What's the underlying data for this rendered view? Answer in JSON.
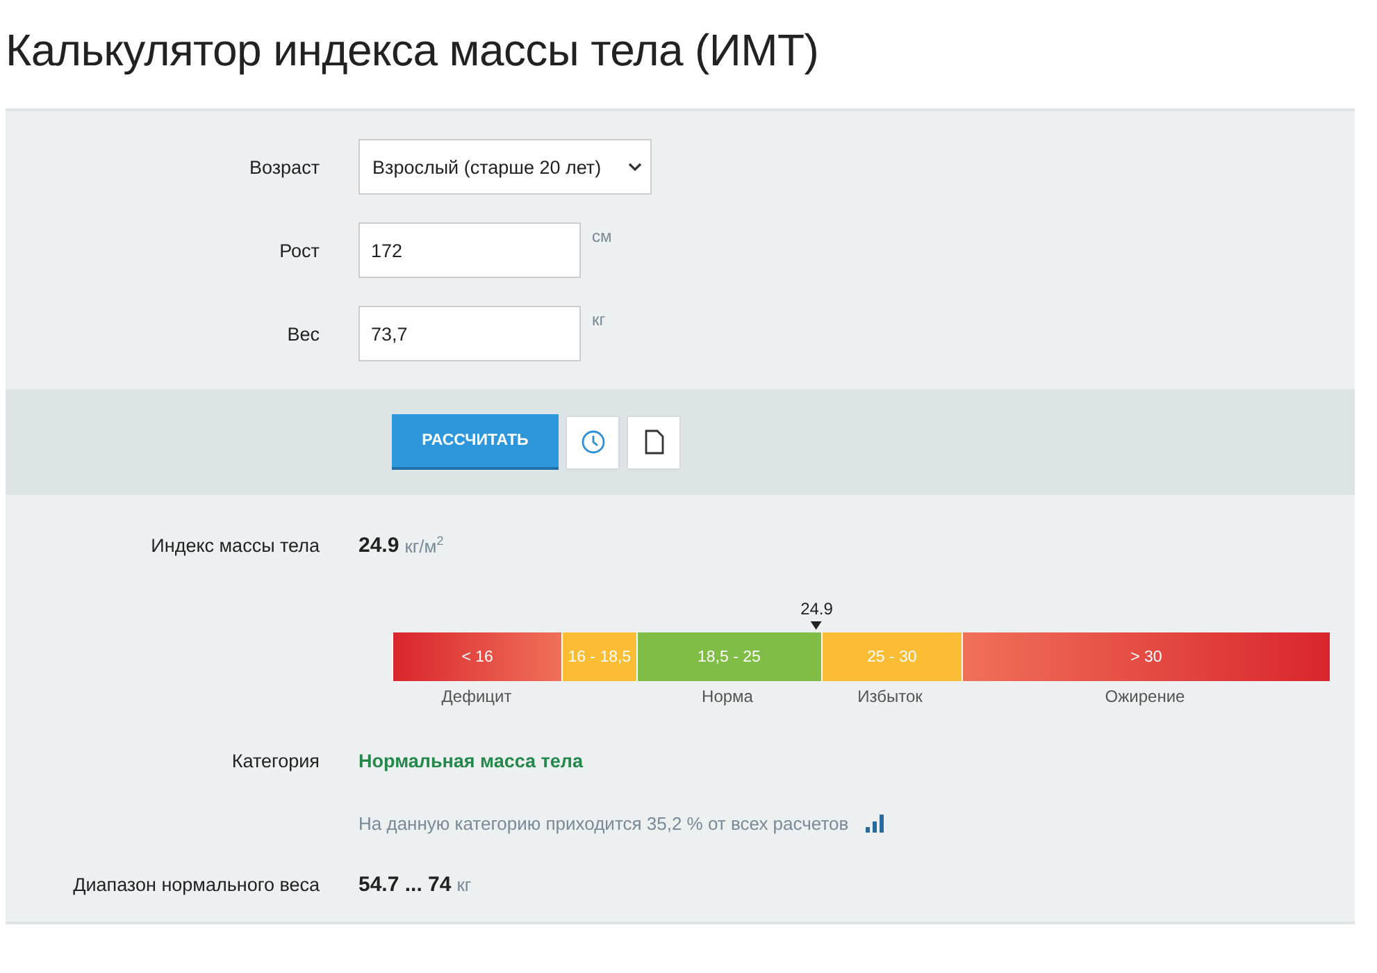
{
  "title": "Калькулятор индекса массы тела (ИМТ)",
  "form": {
    "age": {
      "label": "Возраст",
      "value": "Взрослый (старше 20 лет)"
    },
    "height": {
      "label": "Рост",
      "value": "172",
      "unit": "см"
    },
    "weight": {
      "label": "Вес",
      "value": "73,7",
      "unit": "кг"
    }
  },
  "actions": {
    "calculate": "РАССЧИТАТЬ"
  },
  "result": {
    "label": "Индекс массы тела",
    "value": "24.9",
    "unit": "кг/м",
    "unit_sup": "2",
    "scale": {
      "marker": {
        "label": "24.9",
        "level": 0.453
      },
      "segments": [
        {
          "label": "< 16",
          "caption": "Дефицит",
          "kind": "gradient-red-left"
        },
        {
          "label": "16 - 18,5",
          "kind": "yellow"
        },
        {
          "label": "18,5 - 25",
          "caption": "Норма",
          "kind": "green"
        },
        {
          "label": "25 - 30",
          "caption": "Избыток",
          "kind": "yellow"
        },
        {
          "label": "> 30",
          "caption": "Ожирение",
          "kind": "gradient-red-right"
        }
      ]
    }
  },
  "category": {
    "label": "Категория",
    "value": "Нормальная масса тела",
    "note": "На данную категорию приходится 35,2 % от всех расчетов"
  },
  "range": {
    "label": "Диапазон нормального веса",
    "value": "54.7 ... 74",
    "unit": "кг"
  }
}
